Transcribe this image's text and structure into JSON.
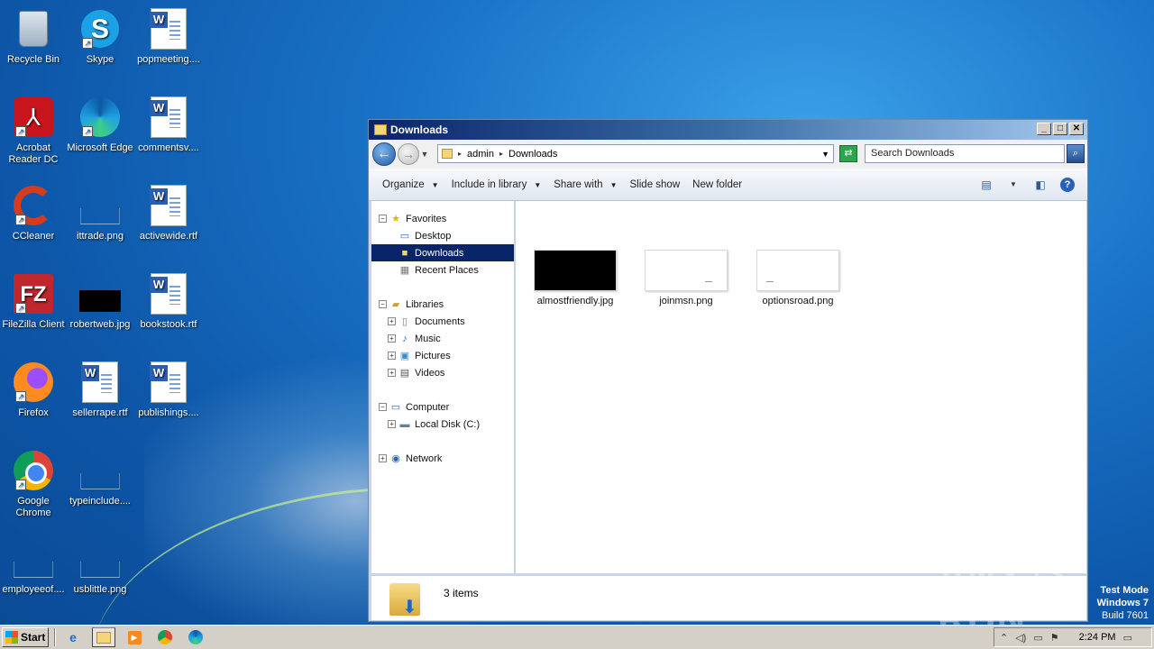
{
  "desktop": {
    "icons": [
      {
        "label": "Recycle Bin",
        "icon": "recycle-bin-icon"
      },
      {
        "label": "Skype",
        "icon": "skype-icon"
      },
      {
        "label": "popmeeting....",
        "icon": "word-doc-icon"
      },
      {
        "label": "Acrobat Reader DC",
        "label_line1": "Acrobat",
        "label_line2": "Reader DC",
        "icon": "acrobat-icon"
      },
      {
        "label": "Microsoft Edge",
        "icon": "edge-icon"
      },
      {
        "label": "commentsv....",
        "icon": "word-doc-icon"
      },
      {
        "label": "CCleaner",
        "icon": "ccleaner-icon"
      },
      {
        "label": "ittrade.png",
        "icon": "blank-image-icon"
      },
      {
        "label": "activewide.rtf",
        "icon": "word-doc-icon"
      },
      {
        "label": "FileZilla Client",
        "icon": "filezilla-icon"
      },
      {
        "label": "robertweb.jpg",
        "icon": "black-image-icon"
      },
      {
        "label": "bookstook.rtf",
        "icon": "word-doc-icon"
      },
      {
        "label": "Firefox",
        "icon": "firefox-icon"
      },
      {
        "label": "sellerrape.rtf",
        "icon": "word-doc-icon"
      },
      {
        "label": "publishings....",
        "icon": "word-doc-icon"
      },
      {
        "label": "Google Chrome",
        "label_line1": "Google",
        "label_line2": "Chrome",
        "icon": "chrome-icon"
      },
      {
        "label": "typeinclude....",
        "icon": "blank-image-icon"
      },
      {
        "label": "employeeof....",
        "icon": "blank-image-icon"
      },
      {
        "label": "usblittle.png",
        "icon": "blank-image-icon"
      }
    ]
  },
  "window": {
    "title": "Downloads",
    "breadcrumb": [
      "admin",
      "Downloads"
    ],
    "search_placeholder": "Search Downloads",
    "toolbar": {
      "organize": "Organize",
      "include_in_library": "Include in library",
      "share_with": "Share with",
      "slide_show": "Slide show",
      "new_folder": "New folder"
    },
    "nav": {
      "favorites": "Favorites",
      "desktop": "Desktop",
      "downloads": "Downloads",
      "recent_places": "Recent Places",
      "libraries": "Libraries",
      "documents": "Documents",
      "music": "Music",
      "pictures": "Pictures",
      "videos": "Videos",
      "computer": "Computer",
      "local_disk": "Local Disk (C:)",
      "network": "Network"
    },
    "files": [
      {
        "name": "almostfriendly.jpg",
        "thumb": "black"
      },
      {
        "name": "joinmsn.png",
        "thumb": "white"
      },
      {
        "name": "optionsroad.png",
        "thumb": "white"
      }
    ],
    "status": "3 items"
  },
  "watermark": "ANY ▷ RUN",
  "test_mode": {
    "line1": "Test Mode",
    "line2": "Windows 7",
    "line3": "Build 7601"
  },
  "taskbar": {
    "start": "Start",
    "clock": "2:24 PM",
    "quick_launch": [
      "ie-icon",
      "explorer-icon",
      "media-player-icon",
      "chrome-icon",
      "edge-icon"
    ]
  },
  "colors": {
    "title_gradient_start": "#0a246a",
    "selection": "#0a246a",
    "desktop_blue": "#1a74c8"
  }
}
